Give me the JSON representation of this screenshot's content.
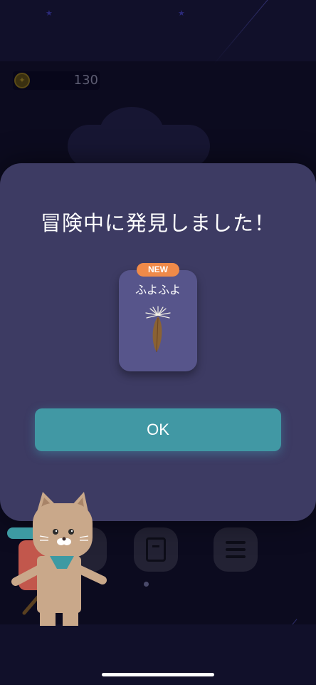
{
  "header": {
    "coin_count": "130"
  },
  "dialog": {
    "title": "冒険中に発見しました！",
    "item": {
      "badge": "NEW",
      "name": "ふよふよ",
      "icon": "feather-icon"
    },
    "ok_label": "OK"
  },
  "menu": {
    "buttons": [
      {
        "icon": "map-icon"
      },
      {
        "icon": "book-icon"
      },
      {
        "icon": "menu-icon"
      }
    ],
    "page_indicator_count": 1
  },
  "colors": {
    "modal_bg": "#3d3b63",
    "card_bg": "#57558b",
    "badge": "#f08a49",
    "ok_button": "#4198a4"
  }
}
